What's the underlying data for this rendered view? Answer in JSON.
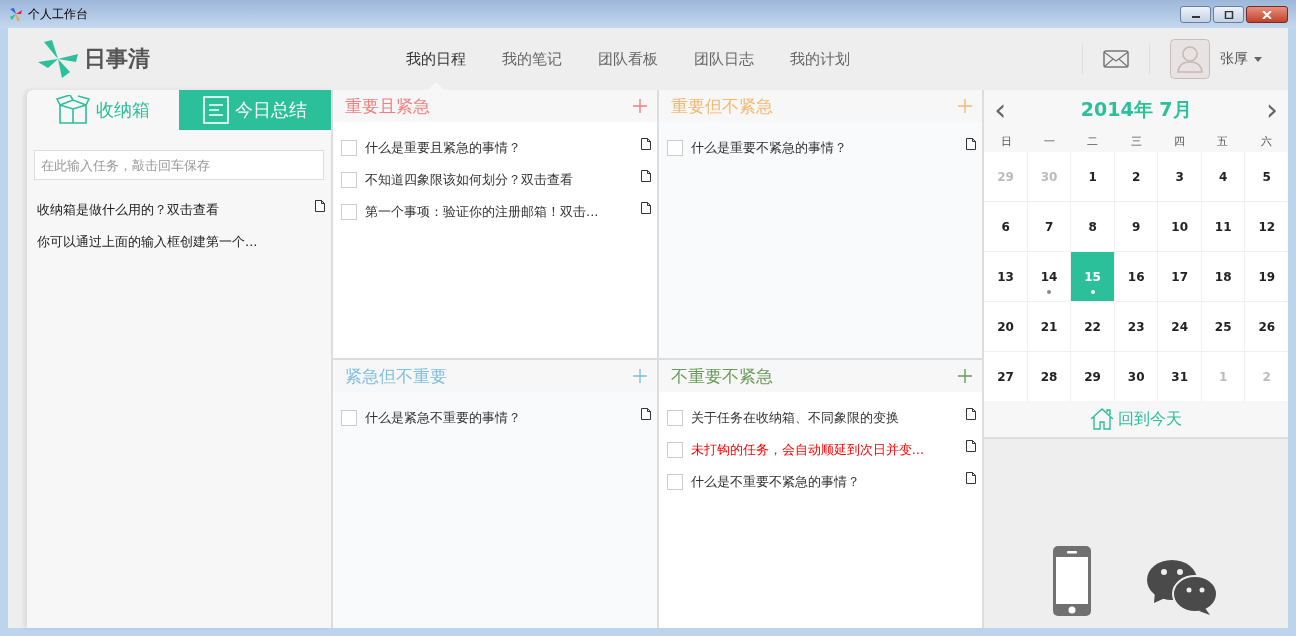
{
  "window": {
    "title": "个人工作台"
  },
  "app": {
    "logo_text": "日事清"
  },
  "nav": [
    {
      "label": "我的日程",
      "selected": true
    },
    {
      "label": "我的笔记",
      "selected": false
    },
    {
      "label": "团队看板",
      "selected": false
    },
    {
      "label": "团队日志",
      "selected": false
    },
    {
      "label": "我的计划",
      "selected": false
    }
  ],
  "user": {
    "name": "张厚"
  },
  "left_tabs": [
    {
      "label": "收纳箱",
      "selected": false,
      "kind": "inbox"
    },
    {
      "label": "今日总结",
      "selected": true,
      "kind": "summary"
    }
  ],
  "inbox": {
    "placeholder": "在此输入任务，敲击回车保存",
    "items": [
      {
        "text": "收纳箱是做什么用的？双击查看",
        "note": true
      },
      {
        "text": "你可以通过上面的输入框创建第一个...",
        "note": false
      }
    ]
  },
  "quadrants": [
    {
      "title": "重要且紧急",
      "color": "#f08080",
      "tasks": [
        {
          "text": "什么是重要且紧急的事情？",
          "checked": false,
          "overdue": false
        },
        {
          "text": "不知道四象限该如何划分？双击查看",
          "checked": false,
          "overdue": false
        },
        {
          "text": "第一个事项：验证你的注册邮箱！双击...",
          "checked": false,
          "overdue": false
        }
      ]
    },
    {
      "title": "重要但不紧急",
      "color": "#f5b870",
      "tasks": [
        {
          "text": "什么是重要不紧急的事情？",
          "checked": false,
          "overdue": false
        }
      ]
    },
    {
      "title": "紧急但不重要",
      "color": "#7fbfdf",
      "tasks": [
        {
          "text": "什么是紧急不重要的事情？",
          "checked": false,
          "overdue": false
        }
      ]
    },
    {
      "title": "不重要不紧急",
      "color": "#6a9a5a",
      "tasks": [
        {
          "text": "关于任务在收纳箱、不同象限的变换",
          "checked": false,
          "overdue": false
        },
        {
          "text": "未打钩的任务，会自动顺延到次日并变...",
          "checked": false,
          "overdue": true
        },
        {
          "text": "什么是不重要不紧急的事情？",
          "checked": false,
          "overdue": false
        }
      ]
    }
  ],
  "calendar": {
    "prev": "‹",
    "title": "2014年 7月",
    "next": "›",
    "weekdays": [
      "日",
      "一",
      "二",
      "三",
      "四",
      "五",
      "六"
    ],
    "weeks": [
      [
        {
          "d": "29",
          "muted": true,
          "selected": false,
          "dot": false
        },
        {
          "d": "30",
          "muted": true,
          "selected": false,
          "dot": false
        },
        {
          "d": "1",
          "muted": false,
          "selected": false,
          "dot": false
        },
        {
          "d": "2",
          "muted": false,
          "selected": false,
          "dot": false
        },
        {
          "d": "3",
          "muted": false,
          "selected": false,
          "dot": false
        },
        {
          "d": "4",
          "muted": false,
          "selected": false,
          "dot": false
        },
        {
          "d": "5",
          "muted": false,
          "selected": false,
          "dot": false
        }
      ],
      [
        {
          "d": "6",
          "muted": false,
          "selected": false,
          "dot": false
        },
        {
          "d": "7",
          "muted": false,
          "selected": false,
          "dot": false
        },
        {
          "d": "8",
          "muted": false,
          "selected": false,
          "dot": false
        },
        {
          "d": "9",
          "muted": false,
          "selected": false,
          "dot": false
        },
        {
          "d": "10",
          "muted": false,
          "selected": false,
          "dot": false
        },
        {
          "d": "11",
          "muted": false,
          "selected": false,
          "dot": false
        },
        {
          "d": "12",
          "muted": false,
          "selected": false,
          "dot": false
        }
      ],
      [
        {
          "d": "13",
          "muted": false,
          "selected": false,
          "dot": false
        },
        {
          "d": "14",
          "muted": false,
          "selected": false,
          "dot": true
        },
        {
          "d": "15",
          "muted": false,
          "selected": true,
          "dot": true
        },
        {
          "d": "16",
          "muted": false,
          "selected": false,
          "dot": false
        },
        {
          "d": "17",
          "muted": false,
          "selected": false,
          "dot": false
        },
        {
          "d": "18",
          "muted": false,
          "selected": false,
          "dot": false
        },
        {
          "d": "19",
          "muted": false,
          "selected": false,
          "dot": false
        }
      ],
      [
        {
          "d": "20",
          "muted": false,
          "selected": false,
          "dot": false
        },
        {
          "d": "21",
          "muted": false,
          "selected": false,
          "dot": false
        },
        {
          "d": "22",
          "muted": false,
          "selected": false,
          "dot": false
        },
        {
          "d": "23",
          "muted": false,
          "selected": false,
          "dot": false
        },
        {
          "d": "24",
          "muted": false,
          "selected": false,
          "dot": false
        },
        {
          "d": "25",
          "muted": false,
          "selected": false,
          "dot": false
        },
        {
          "d": "26",
          "muted": false,
          "selected": false,
          "dot": false
        }
      ],
      [
        {
          "d": "27",
          "muted": false,
          "selected": false,
          "dot": false
        },
        {
          "d": "28",
          "muted": false,
          "selected": false,
          "dot": false
        },
        {
          "d": "29",
          "muted": false,
          "selected": false,
          "dot": false
        },
        {
          "d": "30",
          "muted": false,
          "selected": false,
          "dot": false
        },
        {
          "d": "31",
          "muted": false,
          "selected": false,
          "dot": false
        },
        {
          "d": "1",
          "muted": true,
          "selected": false,
          "dot": false
        },
        {
          "d": "2",
          "muted": true,
          "selected": false,
          "dot": false
        }
      ]
    ],
    "today_button": "回到今天"
  }
}
